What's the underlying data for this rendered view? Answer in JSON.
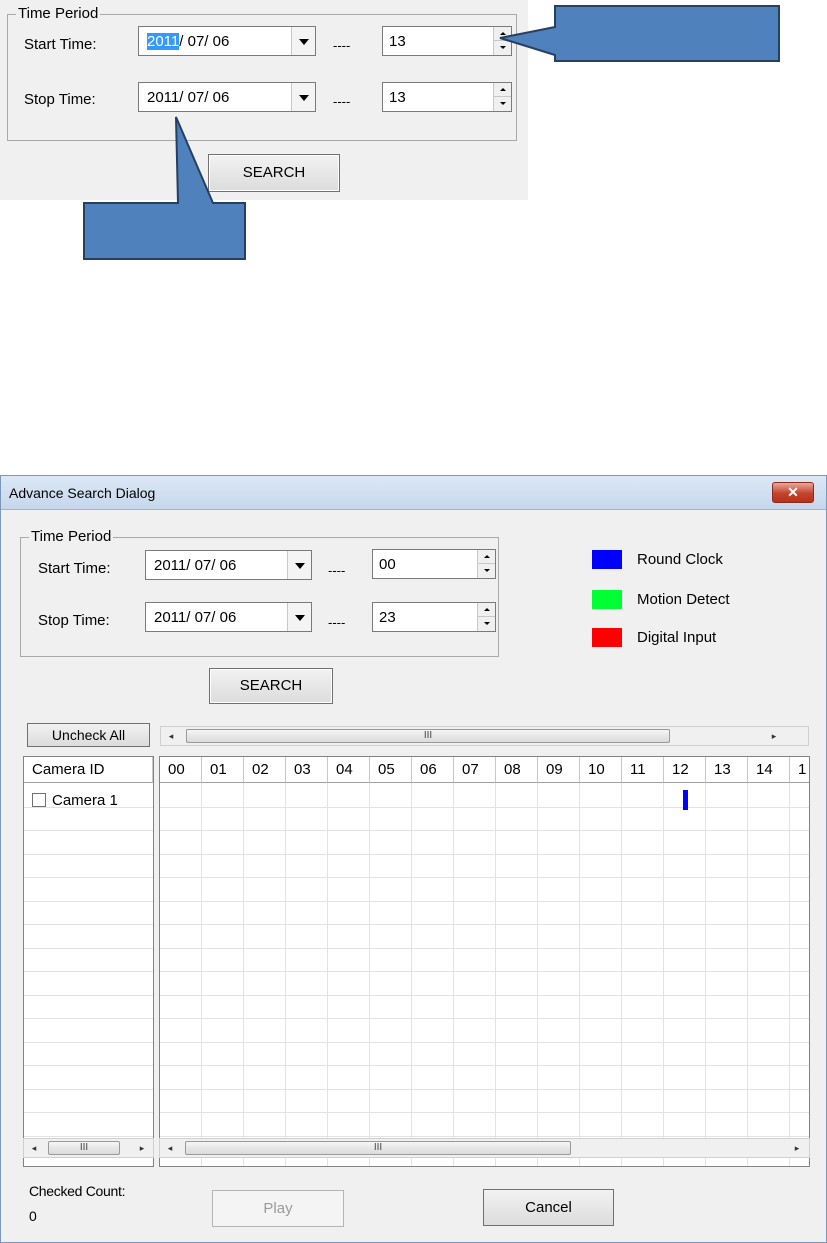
{
  "snippet": {
    "group_title": "Time Period",
    "start_label": "Start Time:",
    "stop_label": "Stop Time:",
    "start_date_highlight": "2011",
    "start_date_rest": "/ 07/ 06",
    "stop_date": "2011/ 07/ 06",
    "separator": "----",
    "start_hour": "13",
    "stop_hour": "13",
    "search_button": "SEARCH"
  },
  "dialog": {
    "title": "Advance Search Dialog",
    "close_glyph": "✕",
    "group_title": "Time Period",
    "start_label": "Start Time:",
    "stop_label": "Stop Time:",
    "start_date": "2011/ 07/ 06",
    "stop_date": "2011/ 07/ 06",
    "separator": "----",
    "start_hour": "00",
    "stop_hour": "23",
    "search_button": "SEARCH",
    "legend": [
      {
        "label": "Round Clock",
        "color": "#0000ff"
      },
      {
        "label": "Motion Detect",
        "color": "#00ff33"
      },
      {
        "label": "Digital Input",
        "color": "#ff0000"
      }
    ],
    "uncheck_all_button": "Uncheck All",
    "camera_column_header": "Camera ID",
    "cameras": [
      {
        "label": "Camera 1",
        "checked": false
      }
    ],
    "hour_columns": [
      "00",
      "01",
      "02",
      "03",
      "04",
      "05",
      "06",
      "07",
      "08",
      "09",
      "10",
      "11",
      "12",
      "13",
      "14",
      "1"
    ],
    "scroll_thumb_glyph": "III",
    "scroll_left_glyph": "◂",
    "scroll_right_glyph": "▸",
    "recording_mark": {
      "camera": "Camera 1",
      "hour": "12",
      "type": "Round Clock"
    },
    "checked_count_label": "Checked Count:",
    "checked_count_value": "0",
    "play_button": "Play",
    "cancel_button": "Cancel"
  }
}
